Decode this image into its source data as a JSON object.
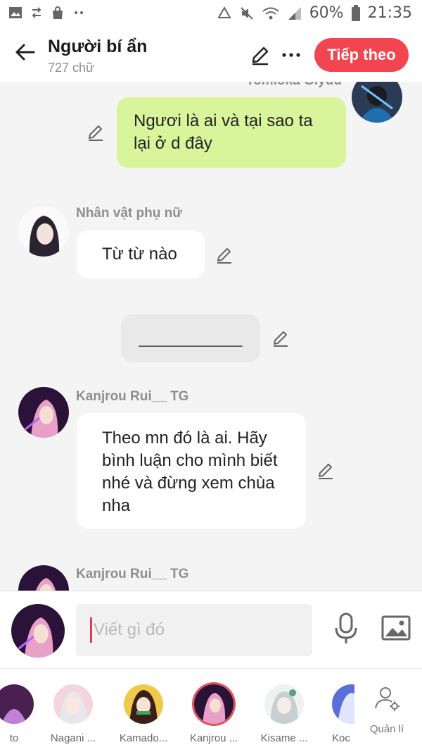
{
  "status_bar": {
    "battery": "60%",
    "time": "21:35",
    "left_icons": [
      "gallery-icon",
      "transfer-icon",
      "shopping-bag-icon",
      "dots-icon"
    ],
    "right_icons": [
      "recycle-icon",
      "mute-icon",
      "wifi-icon",
      "signal-icon",
      "battery-icon"
    ]
  },
  "header": {
    "title": "Người bí ẩn",
    "subtitle": "727 chữ",
    "next_label": "Tiếp theo",
    "accent": "#f2454f"
  },
  "messages": [
    {
      "sender": "Tomioka Giyuu",
      "side": "right",
      "style": "green",
      "text": "Ngươi là ai và tại sao ta lại ở d đây"
    },
    {
      "sender": "Nhân vật phụ nữ",
      "side": "left",
      "style": "white",
      "text": "Từ từ nào"
    },
    {
      "sender": "",
      "side": "center",
      "style": "gray",
      "text": "___________"
    },
    {
      "sender": "Kanjrou Rui__ TG",
      "side": "left",
      "style": "white",
      "text": "Theo mn đó là ai. Hãy bình luận cho mình biết nhé và đừng xem chùa nha"
    },
    {
      "sender": "Kanjrou Rui__ TG",
      "side": "left",
      "style": "white",
      "text": ""
    }
  ],
  "composer": {
    "placeholder": "Viết gì đó"
  },
  "characters": [
    {
      "name": "to",
      "active": false
    },
    {
      "name": "Nagani ...",
      "active": false
    },
    {
      "name": "Kamado...",
      "active": false
    },
    {
      "name": "Kanjrou ...",
      "active": true
    },
    {
      "name": "Kisame ...",
      "active": false
    },
    {
      "name": "Koc",
      "active": false
    }
  ],
  "manage_label": "Quản lí",
  "colors": {
    "bubble_green": "#d9f59b",
    "bubble_white": "#ffffff",
    "bubble_gray": "#e9e9e9",
    "background": "#f4f4f4"
  }
}
